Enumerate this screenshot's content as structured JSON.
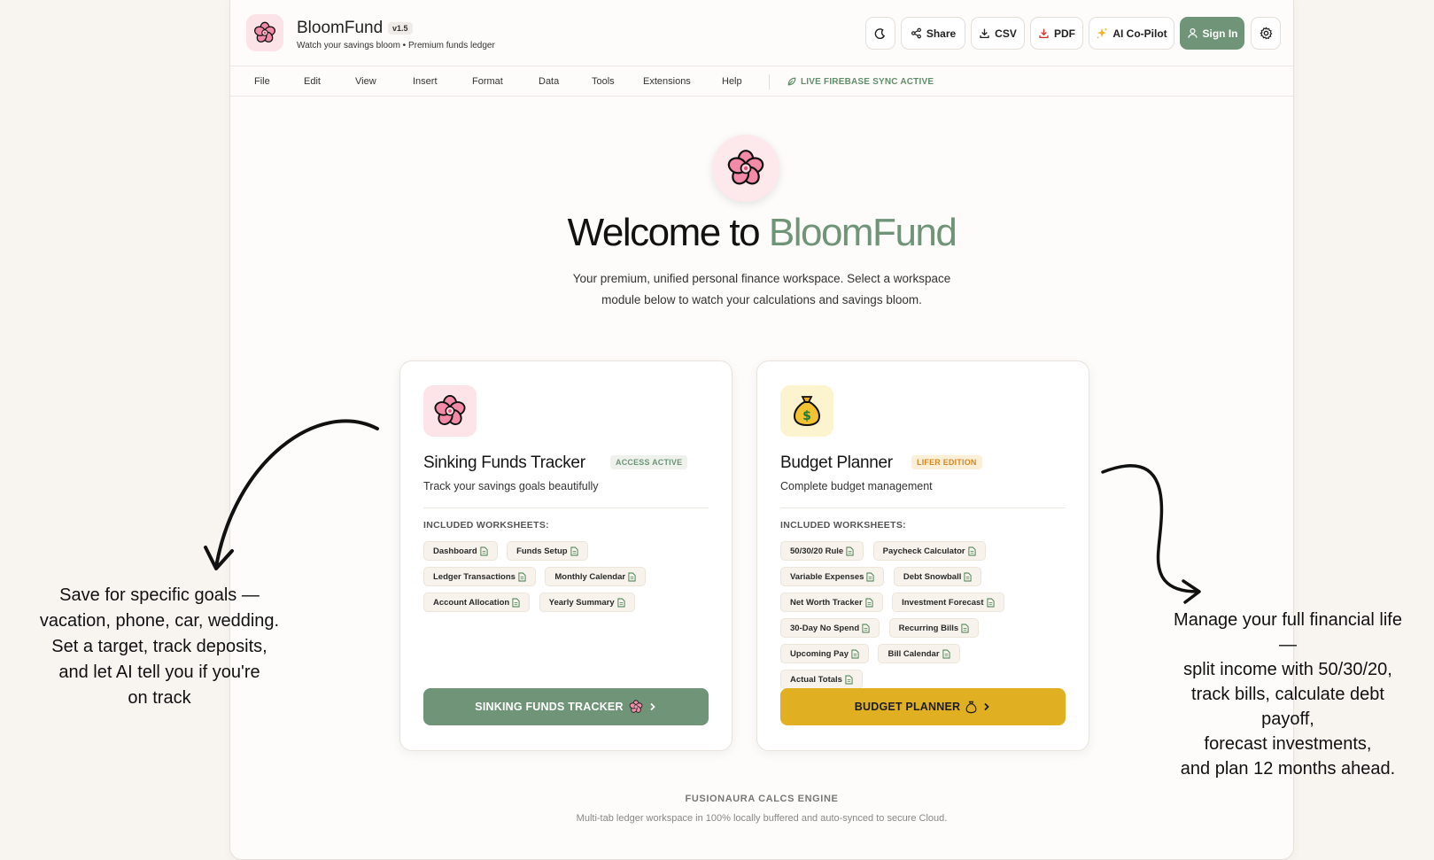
{
  "app": {
    "name": "BloomFund",
    "version": "v1.5",
    "tagline": "Watch your savings bloom • Premium funds ledger"
  },
  "toolbar": {
    "share": "Share",
    "csv": "CSV",
    "pdf": "PDF",
    "copilot": "AI Co-Pilot",
    "signin": "Sign In"
  },
  "menu": {
    "items": [
      "File",
      "Edit",
      "View",
      "Insert",
      "Format",
      "Data",
      "Tools",
      "Extensions",
      "Help"
    ],
    "sync_status": "LIVE FIREBASE SYNC ACTIVE"
  },
  "hero": {
    "welcome_prefix": "Welcome to ",
    "welcome_brand": "BloomFund",
    "intro": "Your premium, unified personal finance workspace. Select a workspace module below to watch your calculations and savings bloom."
  },
  "cards": [
    {
      "title": "Sinking Funds Tracker",
      "badge": "ACCESS ACTIVE",
      "subtitle": "Track your savings goals beautifully",
      "ws_label": "INCLUDED WORKSHEETS:",
      "worksheets": [
        "Dashboard",
        "Funds Setup",
        "Ledger Transactions",
        "Monthly Calendar",
        "Account Allocation",
        "Yearly Summary"
      ],
      "cta": "SINKING FUNDS TRACKER"
    },
    {
      "title": "Budget Planner",
      "badge": "LIFER EDITION",
      "subtitle": "Complete budget management",
      "ws_label": "INCLUDED WORKSHEETS:",
      "worksheets": [
        "50/30/20 Rule",
        "Paycheck Calculator",
        "Variable Expenses",
        "Debt Snowball",
        "Net Worth Tracker",
        "Investment Forecast",
        "30-Day No Spend",
        "Recurring Bills",
        "Upcoming Pay",
        "Bill Calendar",
        "Actual Totals"
      ],
      "cta": "BUDGET PLANNER"
    }
  ],
  "footer": {
    "title": "FUSIONAURA CALCS ENGINE",
    "subtitle": "Multi-tab ledger workspace in 100% locally buffered and auto-synced to secure Cloud."
  },
  "annotations": {
    "left": [
      "Save for specific goals —",
      "vacation, phone, car, wedding.",
      "Set a target, track deposits,",
      "and let AI tell you if you're",
      "on track"
    ],
    "right": [
      "Manage your full financial life",
      "—",
      "split income with 50/30/20,",
      "track bills, calculate debt",
      "payoff,",
      "forecast investments,",
      "and plan 12 months ahead."
    ]
  },
  "colors": {
    "accent_green": "#6f9478",
    "accent_gold": "#e0b022",
    "background": "#f8f5f1"
  }
}
